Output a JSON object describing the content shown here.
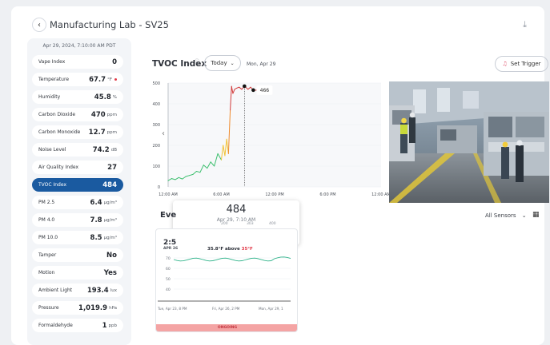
{
  "header": {
    "title": "Manufacturing Lab - SV25",
    "back_icon": "chevron-left-icon",
    "download_icon": "download-icon"
  },
  "sidebar": {
    "timestamp": "Apr 29, 2024, 7:10:00 AM PDT",
    "items": [
      {
        "label": "Vape Index",
        "value": "0",
        "unit": ""
      },
      {
        "label": "Temperature",
        "value": "67.7",
        "unit": "°F",
        "alert": true
      },
      {
        "label": "Humidity",
        "value": "45.8",
        "unit": "%"
      },
      {
        "label": "Carbon Dioxide",
        "value": "470",
        "unit": "ppm"
      },
      {
        "label": "Carbon Monoxide",
        "value": "12.7",
        "unit": "ppm"
      },
      {
        "label": "Noise Level",
        "value": "74.2",
        "unit": "dB"
      },
      {
        "label": "Air Quality Index",
        "value": "27",
        "unit": ""
      },
      {
        "label": "TVOC Index",
        "value": "484",
        "unit": "",
        "active": true
      },
      {
        "label": "PM 2.5",
        "value": "6.4",
        "unit": "µg/m³"
      },
      {
        "label": "PM 4.0",
        "value": "7.8",
        "unit": "µg/m³"
      },
      {
        "label": "PM 10.0",
        "value": "8.5",
        "unit": "µg/m³"
      },
      {
        "label": "Tamper",
        "value": "No",
        "unit": ""
      },
      {
        "label": "Motion",
        "value": "Yes",
        "unit": ""
      },
      {
        "label": "Ambient Light",
        "value": "193.4",
        "unit": "lux"
      },
      {
        "label": "Pressure",
        "value": "1,019.9",
        "unit": "hPa"
      },
      {
        "label": "Formaldehyde",
        "value": "1",
        "unit": "ppb"
      }
    ]
  },
  "main": {
    "chart_title": "TVOC Index",
    "help_icon": "info-icon",
    "range_label": "Today",
    "range_icon": "chevron-down-icon",
    "date_label": "Mon, Apr 29",
    "trigger_label": "Set Trigger",
    "trigger_icon": "bell-icon",
    "events_label": "Eve",
    "sensors_label": "All Sensors",
    "calendar_icon": "calendar-icon"
  },
  "chart_data": {
    "type": "line",
    "title": "TVOC Index",
    "y_ticks": [
      "0",
      "100",
      "200",
      "300",
      "400",
      "500"
    ],
    "x_ticks": [
      "12:00 AM",
      "6:00 AM",
      "12:00 PM",
      "6:00 PM",
      "12:00 AM"
    ],
    "ylim": [
      0,
      500
    ],
    "x_hours": [
      0.0,
      0.4,
      0.8,
      1.2,
      1.6,
      2.0,
      2.4,
      2.8,
      3.2,
      3.6,
      4.0,
      4.4,
      4.8,
      5.2,
      5.6,
      6.0,
      6.2,
      6.4,
      6.6,
      6.8,
      7.0,
      7.15,
      7.3,
      7.5,
      7.7,
      8.0,
      8.3,
      8.6,
      9.0,
      9.3,
      9.6,
      10.0
    ],
    "values": [
      30,
      40,
      35,
      45,
      38,
      50,
      55,
      60,
      75,
      70,
      105,
      90,
      120,
      100,
      160,
      130,
      200,
      150,
      230,
      160,
      370,
      484,
      450,
      470,
      475,
      480,
      470,
      485,
      470,
      480,
      466,
      466
    ],
    "highlight_value": "466",
    "band_colors": {
      "green": "#3cbf6e",
      "yellow": "#f2c233",
      "orange": "#ef8a2b",
      "red": "#d23b3b"
    }
  },
  "tooltip": {
    "value": "484",
    "date": "Apr 29, 7:10 AM",
    "scale": [
      "200",
      "303",
      "400"
    ],
    "warn_icon": "warning-triangle-icon"
  },
  "event_card": {
    "time": "2:5",
    "date": "APR 26",
    "temp": "35.8°F above",
    "threshold": "35°F",
    "y_ticks": [
      "70",
      "60",
      "50",
      "40"
    ],
    "x_ticks": [
      "Tue, Apr 23, 8 PM",
      "Fri, Apr 26, 2 PM",
      "Mon, Apr 29, 1"
    ],
    "status": "ONGOING"
  }
}
